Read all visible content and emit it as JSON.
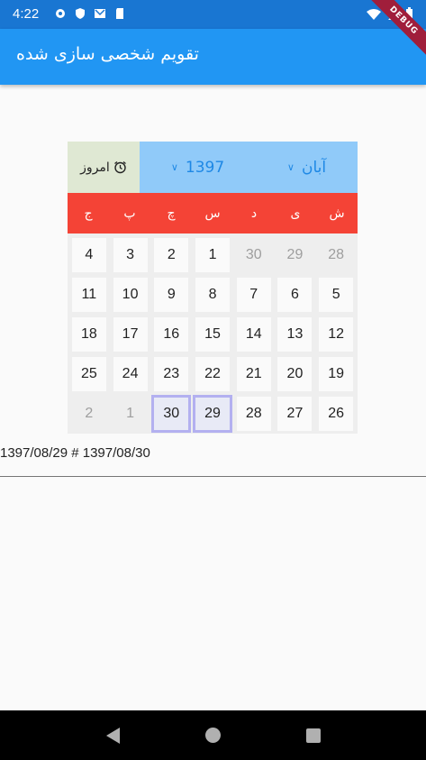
{
  "status_bar": {
    "time": "4:22",
    "left_icons": [
      "gear-icon",
      "shield-icon",
      "mail-icon",
      "sd-card-icon"
    ],
    "right_icons": [
      "wifi-icon",
      "signal-icon",
      "battery-icon"
    ]
  },
  "app_bar": {
    "title": "تقویم شخصی سازی شده",
    "debug_label": "DEBUG"
  },
  "calendar": {
    "today_label": "امروز",
    "today_icon": "alarm-clock-icon",
    "year": "1397",
    "month": "آبان",
    "weekdays": [
      "ج",
      "پ",
      "چ",
      "س",
      "د",
      "ی",
      "ش"
    ],
    "rows": [
      [
        {
          "day": "4"
        },
        {
          "day": "3"
        },
        {
          "day": "2"
        },
        {
          "day": "1"
        },
        {
          "day": "30",
          "out": true
        },
        {
          "day": "29",
          "out": true
        },
        {
          "day": "28",
          "out": true
        }
      ],
      [
        {
          "day": "11"
        },
        {
          "day": "10"
        },
        {
          "day": "9"
        },
        {
          "day": "8"
        },
        {
          "day": "7"
        },
        {
          "day": "6"
        },
        {
          "day": "5"
        }
      ],
      [
        {
          "day": "18"
        },
        {
          "day": "17"
        },
        {
          "day": "16"
        },
        {
          "day": "15"
        },
        {
          "day": "14"
        },
        {
          "day": "13"
        },
        {
          "day": "12"
        }
      ],
      [
        {
          "day": "25"
        },
        {
          "day": "24"
        },
        {
          "day": "23"
        },
        {
          "day": "22"
        },
        {
          "day": "21"
        },
        {
          "day": "20"
        },
        {
          "day": "19"
        }
      ],
      [
        {
          "day": "2",
          "out": true
        },
        {
          "day": "1",
          "out": true
        },
        {
          "day": "30",
          "selected": true
        },
        {
          "day": "29",
          "selected": true
        },
        {
          "day": "28"
        },
        {
          "day": "27"
        },
        {
          "day": "26"
        }
      ]
    ]
  },
  "range_text": "1397/08/29 # 1397/08/30",
  "colors": {
    "status_bar": "#1976d2",
    "app_bar": "#2196f3",
    "month_bar": "#90caf9",
    "weekday_bar": "#f44336",
    "today_bg": "#dfe8d3",
    "selected_border": "#b3b0f0"
  }
}
